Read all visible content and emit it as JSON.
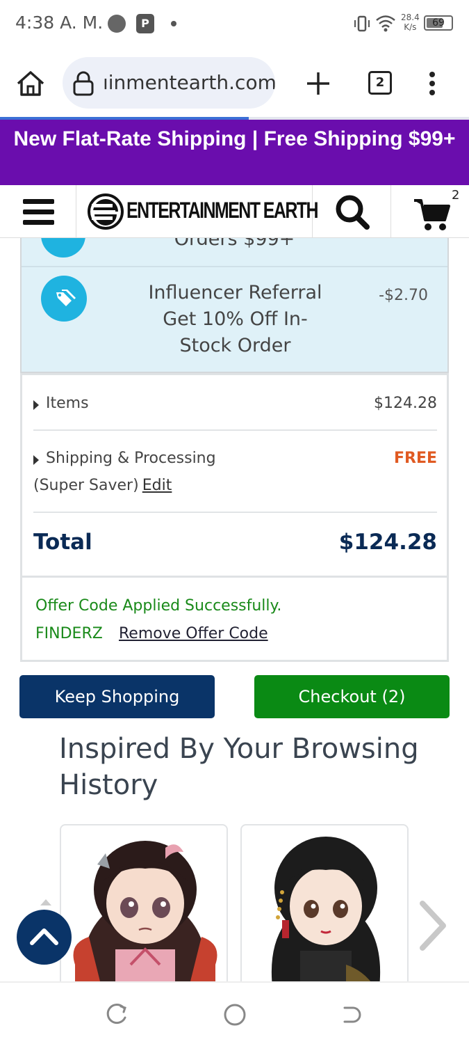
{
  "status_bar": {
    "time": "4:38 A. M.",
    "pip_label": "P",
    "net_speed_value": "28.4",
    "net_speed_unit": "K/s",
    "battery": "69",
    "battery_level": 0.69
  },
  "browser": {
    "url": "ıinmentearth.com",
    "tab_count": "2",
    "load_progress": 0.53,
    "icons": [
      "home-icon",
      "lock-icon",
      "plus-icon",
      "tabs-icon",
      "more-vert-icon"
    ]
  },
  "promo_banner": {
    "text": "New Flat-Rate Shipping | Free Shipping $99+"
  },
  "site_header": {
    "logo_text": "ENTERTAINMENT EARTH",
    "cart_count": "2",
    "icons": [
      "hamburger-icon",
      "logo-icon",
      "search-icon",
      "cart-icon"
    ]
  },
  "discounts": {
    "previous_partial": "Orders $99+",
    "rows": [
      {
        "icon": "tag-icon",
        "description": "Influencer Referral Get 10% Off In-Stock Order",
        "amount": "-$2.70"
      }
    ]
  },
  "summary": {
    "items_label": "Items",
    "items_value": "$124.28",
    "shipping_label": "Shipping & Processing",
    "shipping_value": "FREE",
    "shipping_method": "(Super Saver)",
    "edit_label": "Edit",
    "total_label": "Total",
    "total_value": "$124.28"
  },
  "offer": {
    "message": "Offer Code Applied Successfully.",
    "code": "FINDERZ",
    "remove_label": "Remove Offer Code"
  },
  "buttons": {
    "keep_shopping": "Keep Shopping",
    "checkout": "Checkout (2)"
  },
  "recommendations": {
    "title": "Inspired By Your Browsing History",
    "products": [
      {
        "image": "figure-nezuko"
      },
      {
        "image": "figure-black-hair-kimono"
      }
    ]
  },
  "colors": {
    "promo_bg": "#6a0dad",
    "keep_shopping_bg": "#0a3468",
    "checkout_bg": "#0a8a14",
    "discount_bg": "#dff1f8",
    "tag_circle": "#1fb3e0",
    "free_text": "#e05a22",
    "offer_text": "#1a8a1a",
    "total_text": "#0a2a55"
  }
}
